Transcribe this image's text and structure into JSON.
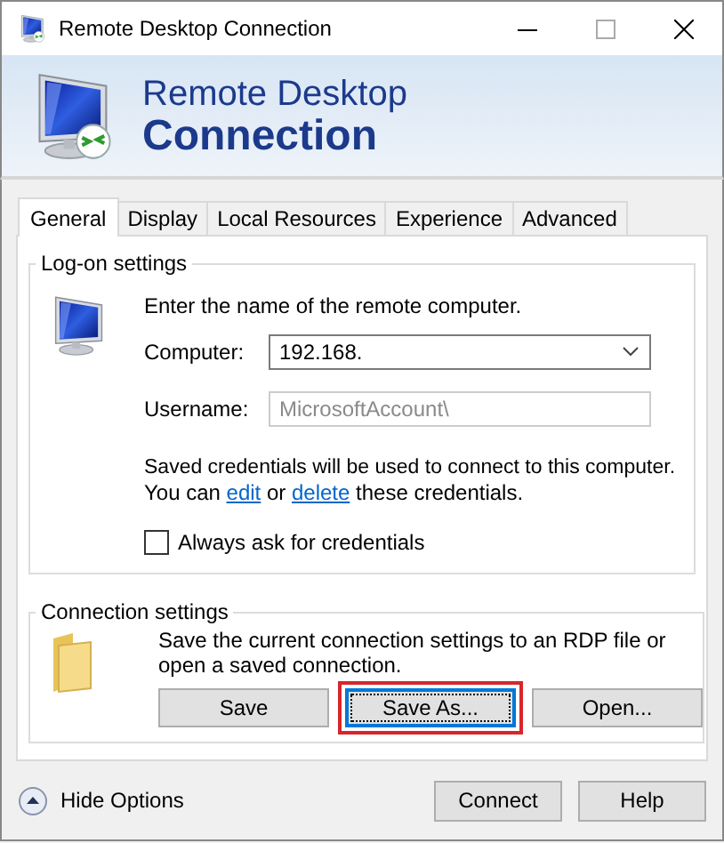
{
  "window": {
    "title": "Remote Desktop Connection"
  },
  "banner": {
    "line_1": "Remote Desktop",
    "line_2": "Connection"
  },
  "tabs": [
    {
      "label": "General",
      "selected": true
    },
    {
      "label": "Display",
      "selected": false
    },
    {
      "label": "Local Resources",
      "selected": false
    },
    {
      "label": "Experience",
      "selected": false
    },
    {
      "label": "Advanced",
      "selected": false
    }
  ],
  "logon_settings": {
    "title": "Log-on settings",
    "prompt": "Enter the name of the remote computer.",
    "computer": {
      "label": "Computer:",
      "value": "192.168."
    },
    "username": {
      "label": "Username:",
      "value": "MicrosoftAccount\\",
      "disabled": true
    },
    "note_line_1": "Saved credentials will be used to connect to this computer.",
    "note_line_2": [
      {
        "kind": "text",
        "text": "You can "
      },
      {
        "kind": "link",
        "text": "edit"
      },
      {
        "kind": "text",
        "text": " or "
      },
      {
        "kind": "link",
        "text": "delete"
      },
      {
        "kind": "text",
        "text": " these credentials."
      }
    ],
    "always_ask": {
      "label": "Always ask for credentials",
      "checked": false
    }
  },
  "connection_settings": {
    "title": "Connection settings",
    "description": "Save the current connection settings to an RDP file or open a saved connection.",
    "buttons": [
      {
        "label": "Save",
        "focused": false,
        "highlighted": false
      },
      {
        "label": "Save As...",
        "focused": true,
        "highlighted": true
      },
      {
        "label": "Open...",
        "focused": false,
        "highlighted": false
      }
    ]
  },
  "footer": {
    "options_toggle": "Hide Options",
    "buttons": [
      "Connect",
      "Help"
    ]
  }
}
